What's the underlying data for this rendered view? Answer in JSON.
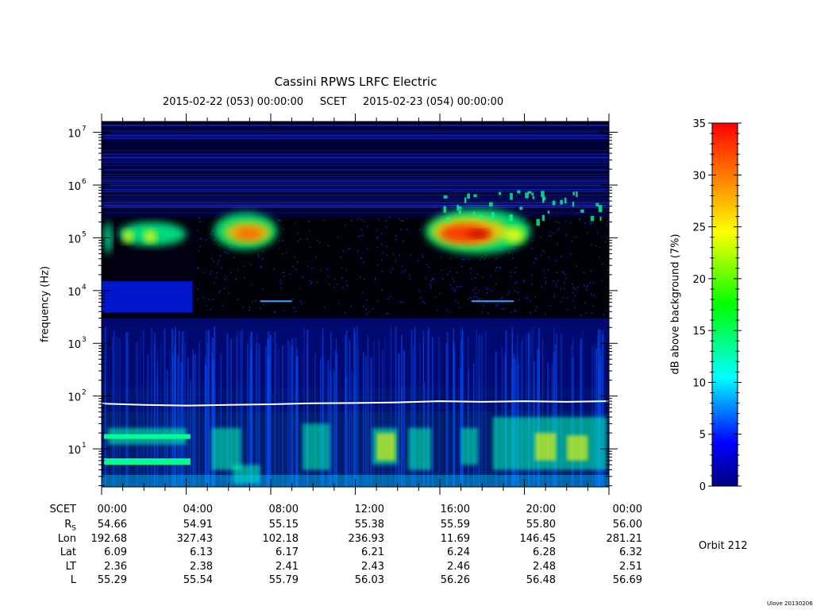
{
  "chart_data": {
    "type": "heatmap",
    "title": "Cassini RPWS LRFC Electric",
    "subtitle": "2015-02-22 (053) 00:00:00     SCET     2015-02-23 (054) 00:00:00",
    "xlabel": "SCET",
    "ylabel": "frequency (Hz)",
    "y_scale": "log",
    "ylim": [
      1.9,
      16000000
    ],
    "y_ticks": [
      10,
      100,
      1000,
      10000,
      100000,
      1000000,
      10000000
    ],
    "y_tick_labels": [
      "10",
      "10",
      "10",
      "10",
      "10",
      "10",
      "10"
    ],
    "y_tick_exponents": [
      "1",
      "2",
      "3",
      "4",
      "5",
      "6",
      "7"
    ],
    "x_ticks_hours": [
      0,
      4,
      8,
      12,
      16,
      20,
      24
    ],
    "x_tick_labels": [
      "00:00",
      "04:00",
      "08:00",
      "12:00",
      "16:00",
      "20:00",
      "00:00"
    ],
    "colorbar": {
      "label": "dB above background (7%)",
      "range": [
        0,
        35
      ],
      "ticks": [
        0,
        5,
        10,
        15,
        20,
        25,
        30,
        35
      ],
      "tick_labels": [
        "0",
        "5",
        "10",
        "15",
        "20",
        "25",
        "30",
        "35"
      ]
    },
    "white_line_hz": [
      [
        0,
        72
      ],
      [
        2,
        68
      ],
      [
        4,
        66
      ],
      [
        6,
        68
      ],
      [
        8,
        70
      ],
      [
        10,
        73
      ],
      [
        12,
        74
      ],
      [
        14,
        76
      ],
      [
        16,
        80
      ],
      [
        18,
        78
      ],
      [
        20,
        80
      ],
      [
        22,
        78
      ],
      [
        24,
        80
      ]
    ],
    "ephemeris": {
      "rows": [
        {
          "label": "R",
          "sub": "S",
          "values": [
            "54.66",
            "54.91",
            "55.15",
            "55.38",
            "55.59",
            "55.80",
            "56.00"
          ]
        },
        {
          "label": "Lon",
          "sub": "",
          "values": [
            "192.68",
            "327.43",
            "102.18",
            "236.93",
            "11.69",
            "146.45",
            "281.21"
          ]
        },
        {
          "label": "Lat",
          "sub": "",
          "values": [
            "6.09",
            "6.13",
            "6.17",
            "6.21",
            "6.24",
            "6.28",
            "6.32"
          ]
        },
        {
          "label": "LT",
          "sub": "",
          "values": [
            "2.36",
            "2.38",
            "2.41",
            "2.43",
            "2.46",
            "2.48",
            "2.51"
          ]
        },
        {
          "label": "L",
          "sub": "",
          "values": [
            "55.29",
            "55.54",
            "55.79",
            "56.03",
            "56.26",
            "56.48",
            "56.69"
          ]
        }
      ]
    }
  },
  "orbit": "Orbit 212",
  "version": "Ulove 20130206",
  "colors": {
    "background": "#000000",
    "axis": "#000000",
    "line": "#ffffff"
  }
}
